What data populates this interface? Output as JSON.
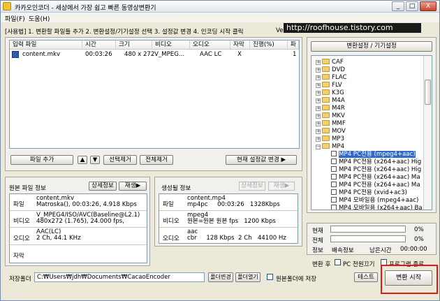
{
  "app": {
    "title": "카카오인코더 - 세상에서 가장 쉽고 빠른 동영상변환기",
    "window_buttons": [
      "_",
      "□",
      "X"
    ]
  },
  "menu": [
    "파일(F)",
    "도움(H)"
  ],
  "steps_text": "[사용법] 1. 변환할 파일들 추가   2. 변환설정/기기설정 선택   3. 설정값 변경   4. 인코딩 시작 클릭",
  "version_text": "Ver",
  "watermark": "http://roofhouse.tistory.com",
  "file_table": {
    "columns": [
      "입력 파일",
      "시간",
      "크기",
      "비디오",
      "오디오",
      "자막",
      "진행(%)",
      "파"
    ],
    "rows": [
      {
        "name": "content.mkv",
        "time": "00:03:26",
        "size": "480 x 272",
        "video": "V_MPEG...",
        "audio": "AAC LC",
        "subtitle": "X",
        "progress": "",
        "extra": "1"
      }
    ]
  },
  "file_buttons": {
    "add": "파일 추가",
    "up": "▲",
    "down": "▼",
    "remove_selected": "선택제거",
    "remove_all": "전체제거",
    "current_settings": "현재 설정값 변경 ▶"
  },
  "source_info": {
    "title": "원본 파일 정보",
    "detail_button": "상세정보",
    "play_button": "재생▶",
    "rows": [
      {
        "label": "파일",
        "value": "content.mkv\nMatroska(), 00:03:26, 4.918 Kbps"
      },
      {
        "label": "비디오",
        "value": "V_MPEG4/ISO/AVC(Baseline@L2.1)\n480x272 (1.765), 24.000 fps,"
      },
      {
        "label": "오디오",
        "value": "AAC(LC)\n2 Ch, 44.1 KHz"
      },
      {
        "label": "자막",
        "value": ""
      }
    ]
  },
  "output_info": {
    "title": "생성될 정보",
    "detail_button": "상세정보",
    "play_button": "재생▶",
    "rows": [
      {
        "label": "파일",
        "value": "content.mp4\nmp4pc     00:03:26   1328Kbps"
      },
      {
        "label": "비디오",
        "value": "mpeg4\n원본=원본 원본 fps   1200 Kbps"
      },
      {
        "label": "오디오",
        "value": "aac\ncbr     128 Kbps  2 Ch   44100 Hz"
      }
    ]
  },
  "output_folder": {
    "label": "저장폴더",
    "path": "C:₩Users₩jdh₩Documents₩CacaoEncoder",
    "change_button": "폴더변경",
    "open_button": "폴더열기",
    "same_folder_label": "원본폴더에 저장"
  },
  "settings_panel": {
    "title": "변환설정 / 기기설정",
    "tree": [
      {
        "label": "CAF",
        "kind": "folder"
      },
      {
        "label": "DVD",
        "kind": "folder"
      },
      {
        "label": "FLAC",
        "kind": "folder"
      },
      {
        "label": "FLV",
        "kind": "folder"
      },
      {
        "label": "K3G",
        "kind": "folder"
      },
      {
        "label": "M4A",
        "kind": "folder"
      },
      {
        "label": "M4R",
        "kind": "folder"
      },
      {
        "label": "MKV",
        "kind": "folder"
      },
      {
        "label": "MMF",
        "kind": "folder"
      },
      {
        "label": "MOV",
        "kind": "folder"
      },
      {
        "label": "MP3",
        "kind": "folder"
      },
      {
        "label": "MP4",
        "kind": "folder-open"
      },
      {
        "label": "MP4 PC전용 (mpeg4+aac)",
        "kind": "preset",
        "selected": true
      },
      {
        "label": "MP4 PC전용 (x264+aac) Hig",
        "kind": "preset"
      },
      {
        "label": "MP4 PC전용 (x264+aac) Hig",
        "kind": "preset"
      },
      {
        "label": "MP4 PC전용 (x264+aac) Ma",
        "kind": "preset"
      },
      {
        "label": "MP4 PC전용 (x264+aac) Ma",
        "kind": "preset"
      },
      {
        "label": "MP4 PC전용 (xvid+ac3)",
        "kind": "preset"
      },
      {
        "label": "MP4 모바일용 (mpeg4+aac)",
        "kind": "preset"
      },
      {
        "label": "MP4 모바일용 (x264+aac) Ba",
        "kind": "preset"
      }
    ]
  },
  "progress": {
    "current_label": "현재",
    "current_value": "0%",
    "current_fraction": 0,
    "total_label": "전체",
    "total_value": "0%",
    "total_fraction": 0,
    "info_label": "정보",
    "speed_label": "배속정보",
    "remaining_label": "남은시간",
    "remaining_time": "00:00:00"
  },
  "after_convert": {
    "label": "변환 후",
    "pc_off": "PC 전원끄기",
    "program_exit": "프로그램 종료"
  },
  "buttons": {
    "test": "테스트",
    "start": "변환 시작"
  },
  "colors": {
    "selection": "#3169c6",
    "highlight_box": "#e11919"
  }
}
